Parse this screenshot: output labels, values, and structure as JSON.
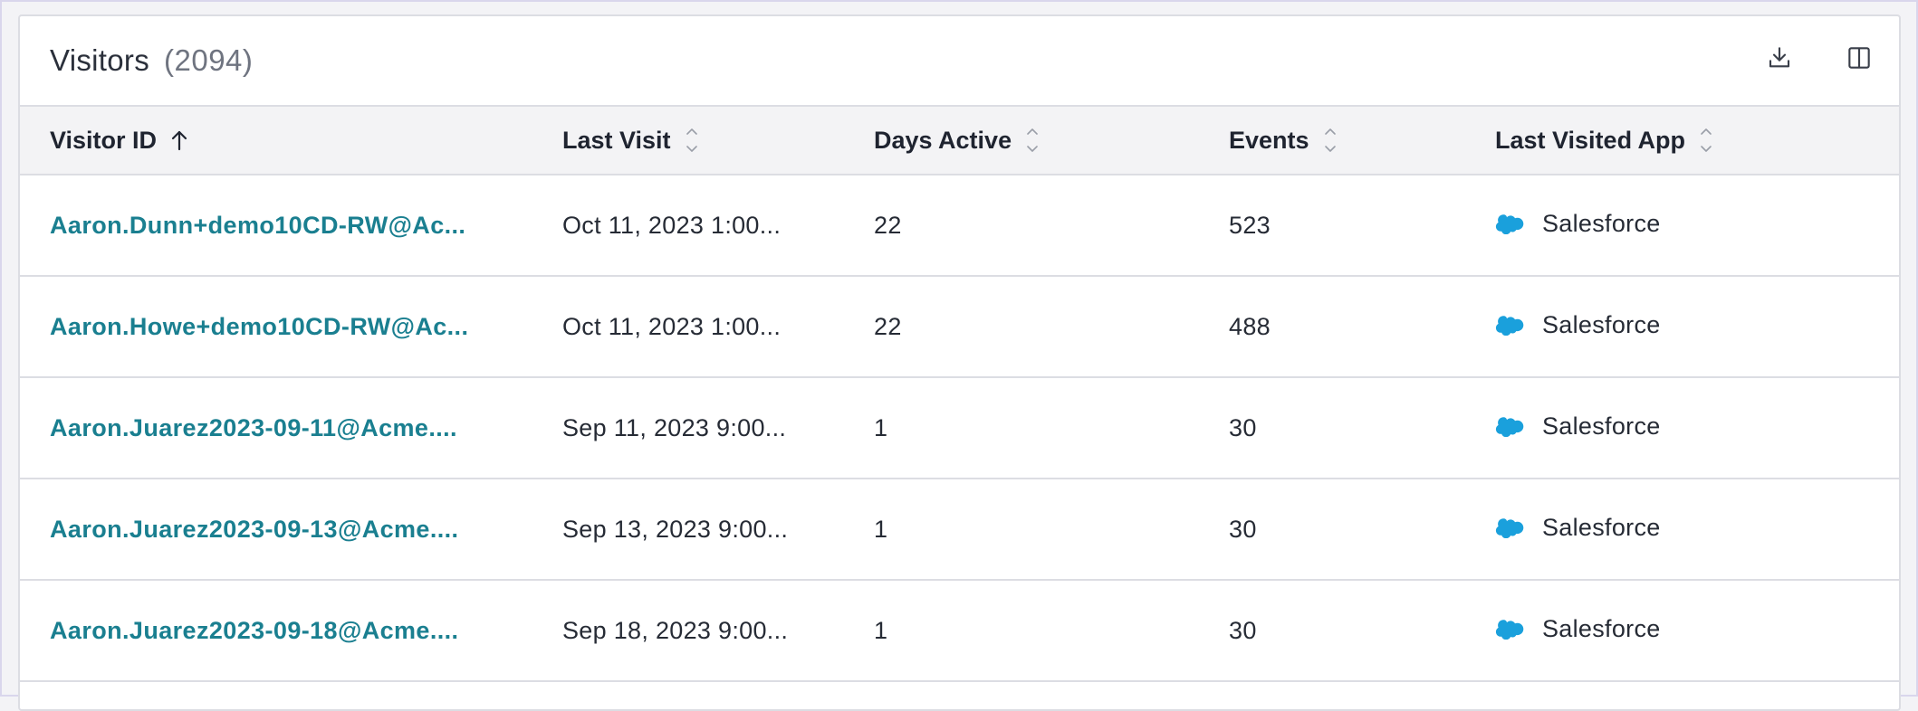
{
  "panel": {
    "title": "Visitors",
    "count": "(2094)",
    "download_icon": "download-icon",
    "columns_icon": "columns-toggle-icon"
  },
  "table": {
    "columns": [
      {
        "label": "Visitor ID",
        "sort": "ascending"
      },
      {
        "label": "Last Visit",
        "sort": "none"
      },
      {
        "label": "Days Active",
        "sort": "none"
      },
      {
        "label": "Events",
        "sort": "none"
      },
      {
        "label": "Last Visited App",
        "sort": "none"
      }
    ],
    "rows": [
      {
        "visitor_id": "Aaron.Dunn+demo10CD-RW@Ac...",
        "last_visit": "Oct 11, 2023 1:00...",
        "days_active": "22",
        "events": "523",
        "app": "Salesforce"
      },
      {
        "visitor_id": "Aaron.Howe+demo10CD-RW@Ac...",
        "last_visit": "Oct 11, 2023 1:00...",
        "days_active": "22",
        "events": "488",
        "app": "Salesforce"
      },
      {
        "visitor_id": "Aaron.Juarez2023-09-11@Acme....",
        "last_visit": "Sep 11, 2023 9:00...",
        "days_active": "1",
        "events": "30",
        "app": "Salesforce"
      },
      {
        "visitor_id": "Aaron.Juarez2023-09-13@Acme....",
        "last_visit": "Sep 13, 2023 9:00...",
        "days_active": "1",
        "events": "30",
        "app": "Salesforce"
      },
      {
        "visitor_id": "Aaron.Juarez2023-09-18@Acme....",
        "last_visit": "Sep 18, 2023 9:00...",
        "days_active": "1",
        "events": "30",
        "app": "Salesforce"
      }
    ],
    "app_icon": "salesforce-cloud-icon"
  },
  "colors": {
    "link": "#1a7f90",
    "salesforce": "#1aa0dc",
    "header_bg": "#f3f3f5",
    "border": "#dcdde3"
  }
}
